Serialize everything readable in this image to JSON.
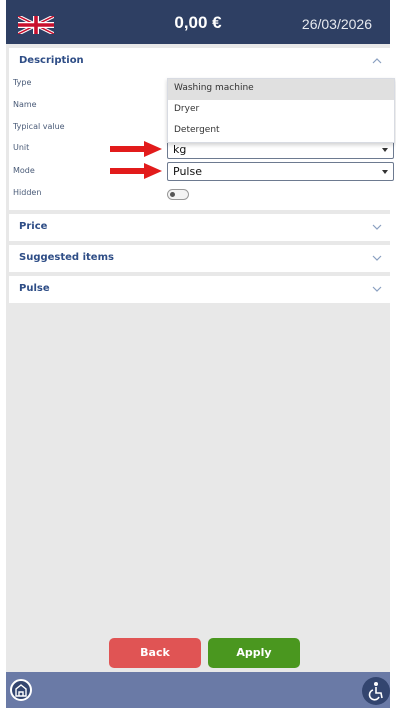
{
  "header": {
    "amount": "0,00 €",
    "date": "26/03/2026",
    "flag_icon": "uk-flag-icon"
  },
  "description": {
    "title": "Description",
    "fields": {
      "type_label": "Type",
      "name_label": "Name",
      "typical_label": "Typical value",
      "unit_label": "Unit",
      "mode_label": "Mode",
      "hidden_label": "Hidden"
    },
    "type_dropdown_options": [
      "Washing machine",
      "Dryer",
      "Detergent"
    ],
    "unit_value": "kg",
    "mode_value": "Pulse",
    "hidden": false
  },
  "sections": [
    {
      "title": "Price"
    },
    {
      "title": "Suggested items"
    },
    {
      "title": "Pulse"
    }
  ],
  "actions": {
    "back_label": "Back",
    "apply_label": "Apply"
  },
  "colors": {
    "header_bg": "#2e3f63",
    "accent": "#2e4d86",
    "back": "#e05454",
    "apply": "#4a971f",
    "arrow": "#e21b1b",
    "bottom_bar": "#6a7aa6"
  }
}
